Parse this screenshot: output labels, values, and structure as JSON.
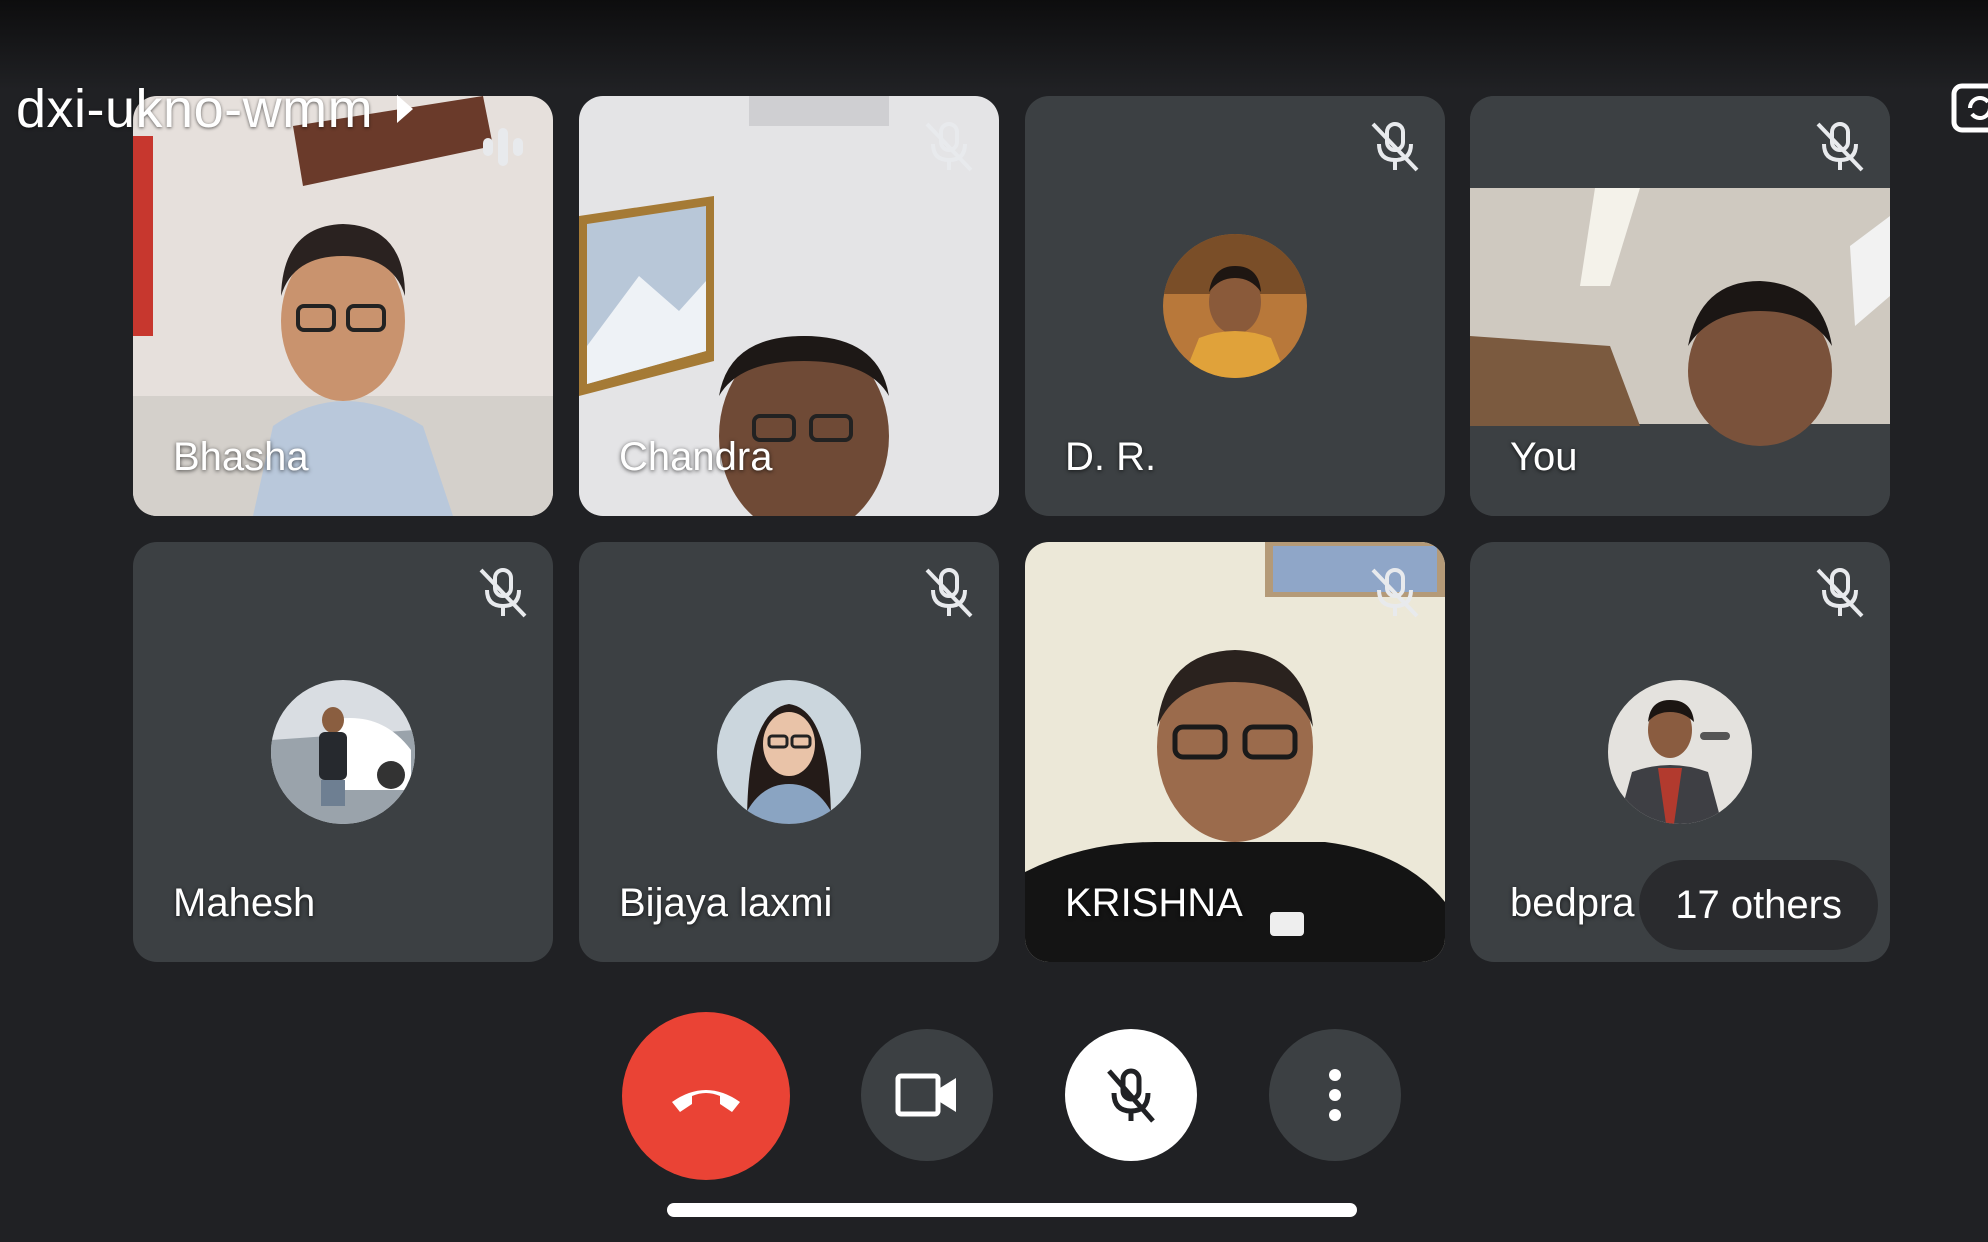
{
  "meeting": {
    "code": "dxi-ukno-wmm"
  },
  "participants": [
    {
      "name": "Bhasha",
      "muted": false,
      "speaking": true,
      "video": true
    },
    {
      "name": "Chandra",
      "muted": true,
      "video": true
    },
    {
      "name": "D. R.",
      "muted": true,
      "video": false
    },
    {
      "name": "You",
      "muted": true,
      "video": true
    },
    {
      "name": "Mahesh",
      "muted": true,
      "video": false
    },
    {
      "name": "Bijaya laxmi",
      "muted": true,
      "video": false
    },
    {
      "name": "KRISHNA",
      "muted": true,
      "video": true
    },
    {
      "name": "bedpra",
      "muted": true,
      "video": false
    }
  ],
  "others": {
    "label": "17 others"
  },
  "controls": {
    "end_call": "phone-hangup-icon",
    "camera": "videocam-icon",
    "microphone": "mic-off-icon",
    "more": "more-vert-icon"
  },
  "colors": {
    "background": "#202124",
    "tile": "#3c4043",
    "end_call": "#ea4335",
    "mic_active_bg": "#ffffff",
    "control_bg": "#3c4043"
  }
}
